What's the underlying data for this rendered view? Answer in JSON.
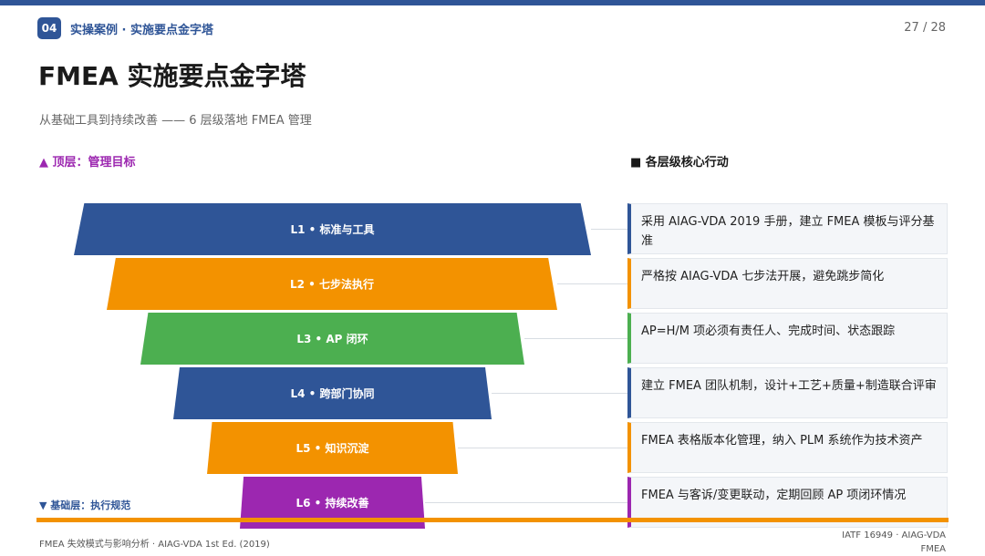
{
  "header": {
    "badge": "04",
    "section_title": "实操案例 · 实施要点金字塔",
    "page_number": "27 / 28"
  },
  "title": "FMEA 实施要点金字塔",
  "subtitle": "从基础工具到持续改善 —— 6 层级落地 FMEA 管理",
  "labels": {
    "top": "▲ 顶层：管理目标",
    "base": "▼ 基础层：执行规范",
    "actions_heading": "■ 各层级核心行动"
  },
  "layers": [
    {
      "label": "L1 • 标准与工具",
      "color": "#2f5597",
      "action": "采用 AIAG-VDA 2019 手册，建立 FMEA 模板与评分基准"
    },
    {
      "label": "L2 • 七步法执行",
      "color": "#f39200",
      "action": "严格按 AIAG-VDA 七步法开展，避免跳步简化"
    },
    {
      "label": "L3 • AP 闭环",
      "color": "#4caf50",
      "action": "AP=H/M 项必须有责任人、完成时间、状态跟踪"
    },
    {
      "label": "L4 • 跨部门协同",
      "color": "#2f5597",
      "action": "建立 FMEA 团队机制，设计+工艺+质量+制造联合评审"
    },
    {
      "label": "L5 • 知识沉淀",
      "color": "#f39200",
      "action": "FMEA 表格版本化管理，纳入 PLM 系统作为技术资产"
    },
    {
      "label": "L6 • 持续改善",
      "color": "#9c27b0",
      "action": "FMEA 与客诉/变更联动，定期回顾 AP 项闭环情况"
    }
  ],
  "footer": {
    "left": "FMEA 失效模式与影响分析 · AIAG-VDA 1st Ed. (2019)",
    "right": "IATF 16949 · AIAG-VDA FMEA"
  },
  "colors": {
    "brand_blue": "#2f5597",
    "orange": "#f39200",
    "green": "#4caf50",
    "purple": "#9c27b0"
  }
}
